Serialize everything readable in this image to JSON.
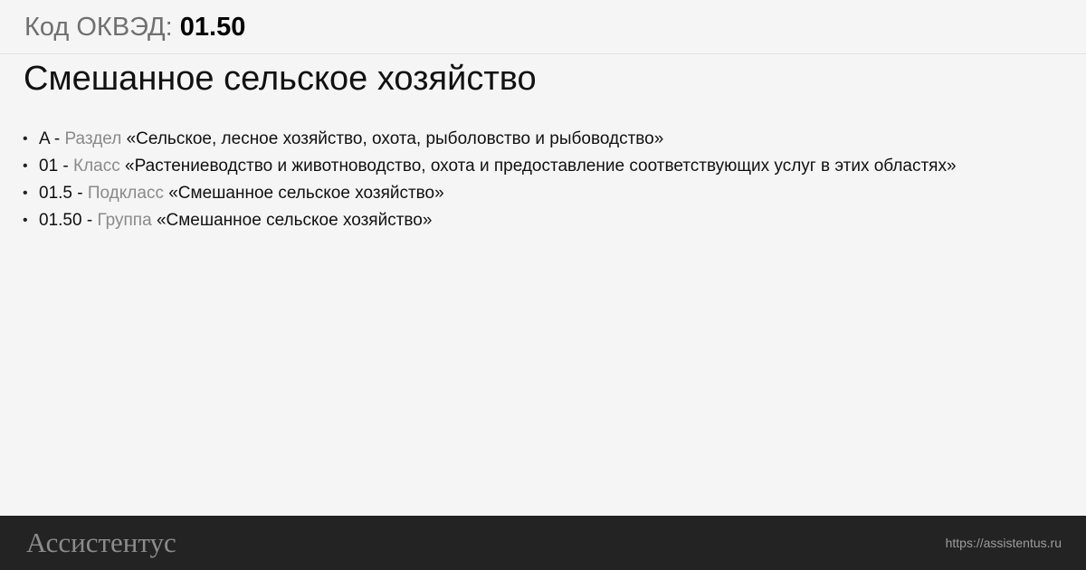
{
  "header": {
    "code_label": "Код ОКВЭД:",
    "code_value": "01.50"
  },
  "title": "Смешанное сельское хозяйство",
  "hierarchy": [
    {
      "code": "A -",
      "type": "Раздел",
      "name": "«Сельское, лесное хозяйство, охота, рыболовство и рыбоводство»"
    },
    {
      "code": "01 -",
      "type": "Класс",
      "name": "«Растениеводство и животноводство, охота и предоставление соответствующих услуг в этих областях»"
    },
    {
      "code": "01.5 -",
      "type": "Подкласс",
      "name": "«Смешанное сельское хозяйство»"
    },
    {
      "code": "01.50 -",
      "type": "Группа",
      "name": "«Смешанное сельское хозяйство»"
    }
  ],
  "footer": {
    "brand": "Ассистентус",
    "url": "https://assistentus.ru"
  }
}
